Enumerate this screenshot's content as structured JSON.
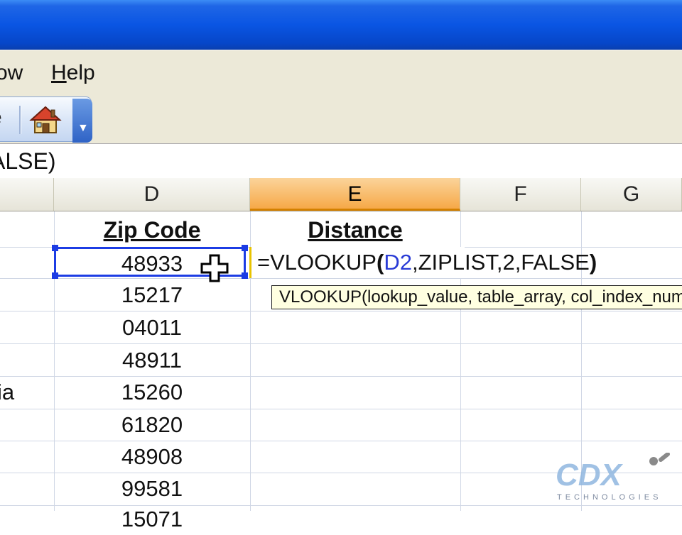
{
  "menubar": {
    "window_partial": "ow",
    "help_first": "H",
    "help_rest": "elp"
  },
  "toolbar": {
    "partial_label": "e",
    "home_icon": "home-icon",
    "overflow_icon": "chevron-down-icon"
  },
  "formula_bar": {
    "text": "ALSE)"
  },
  "columns": [
    {
      "label": "D",
      "active": false
    },
    {
      "label": "E",
      "active": true
    },
    {
      "label": "F",
      "active": false
    },
    {
      "label": "G",
      "active": false
    }
  ],
  "sheet": {
    "header_zip": "Zip Code",
    "header_distance": "Distance",
    "partial_left_text": "ia",
    "zip_codes": [
      "48933",
      "15217",
      "04011",
      "48911",
      "15260",
      "61820",
      "48908",
      "99581",
      "15071"
    ]
  },
  "editing": {
    "prefix": "=VLOOKUP",
    "paren_open": "(",
    "ref": "D2",
    "suffix": ",ZIPLIST,2,FALSE",
    "paren_close": ")"
  },
  "tooltip": {
    "text": "VLOOKUP(lookup_value, table_array, col_index_num, [range_lookup])"
  },
  "watermark": {
    "brand": "CDX",
    "sub": "TECHNOLOGIES"
  },
  "colors": {
    "title_blue": "#0a55e3",
    "active_header": "#f6a948",
    "selection": "#1c3ce4",
    "ref_blue": "#2a3cd6",
    "tooltip_bg": "#ffffe1"
  }
}
